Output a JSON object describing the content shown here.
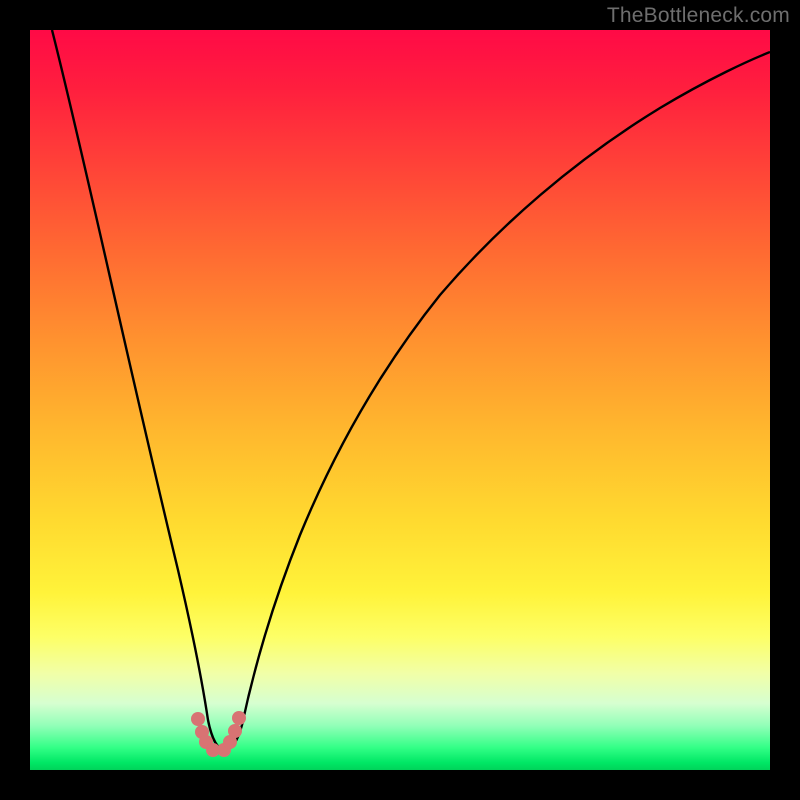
{
  "watermark": "TheBottleneck.com",
  "chart_data": {
    "type": "line",
    "title": "",
    "xlabel": "",
    "ylabel": "",
    "xlim": [
      0,
      100
    ],
    "ylim": [
      0,
      100
    ],
    "grid": false,
    "background_gradient": {
      "top": "#ff0a46",
      "mid": "#fff33a",
      "bottom": "#00d35a"
    },
    "series": [
      {
        "name": "bottleneck-curve",
        "color": "#000000",
        "x": [
          3,
          5,
          8,
          11,
          14,
          17,
          20,
          22,
          23.5,
          25,
          26.5,
          28,
          30,
          33,
          37,
          42,
          48,
          55,
          63,
          72,
          82,
          92,
          100
        ],
        "y": [
          100,
          89,
          76,
          63,
          50,
          37,
          24,
          13,
          6,
          2.2,
          6,
          13,
          22,
          33,
          44,
          54,
          63,
          71,
          78,
          84,
          89,
          93,
          96
        ]
      }
    ],
    "markers": {
      "name": "valley-markers",
      "color": "#d87373",
      "x": [
        22.3,
        22.8,
        23.3,
        24.1,
        25.6,
        26.4,
        27.0,
        27.5
      ],
      "y": [
        7.0,
        5.2,
        3.8,
        2.7,
        2.7,
        3.8,
        5.4,
        7.2
      ]
    },
    "valley_x": 25.0
  }
}
